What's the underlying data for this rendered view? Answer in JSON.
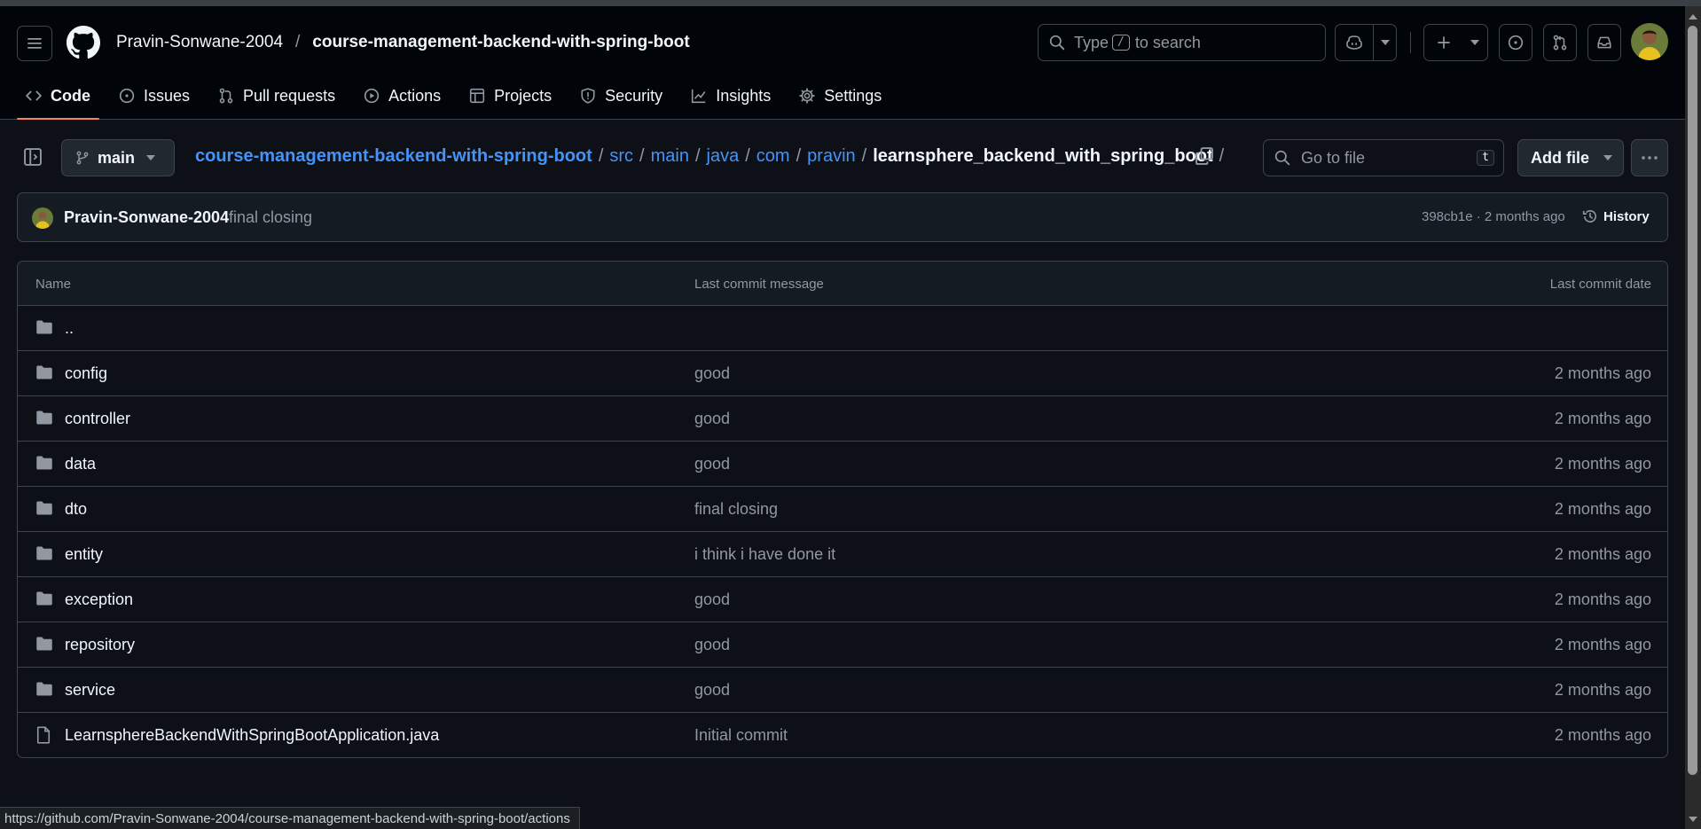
{
  "header": {
    "owner": "Pravin-Sonwane-2004",
    "separator": "/",
    "repo": "course-management-backend-with-spring-boot",
    "search_prefix": "Type",
    "search_key": "/",
    "search_suffix": "to search"
  },
  "tabs": [
    {
      "label": "Code",
      "icon": "code-icon",
      "active": true
    },
    {
      "label": "Issues",
      "icon": "issue-opened-icon"
    },
    {
      "label": "Pull requests",
      "icon": "git-pull-request-icon"
    },
    {
      "label": "Actions",
      "icon": "play-icon"
    },
    {
      "label": "Projects",
      "icon": "table-icon"
    },
    {
      "label": "Security",
      "icon": "shield-icon"
    },
    {
      "label": "Insights",
      "icon": "graph-icon"
    },
    {
      "label": "Settings",
      "icon": "gear-icon"
    }
  ],
  "filenav": {
    "branch": "main",
    "breadcrumb": [
      "course-management-backend-with-spring-boot",
      "src",
      "main",
      "java",
      "com",
      "pravin"
    ],
    "current": "learnsphere_backend_with_spring_boot",
    "trailing_sep": "/",
    "goto_placeholder": "Go to file",
    "goto_key": "t",
    "add_file": "Add file"
  },
  "commit": {
    "author": "Pravin-Sonwane-2004",
    "message": "final closing",
    "meta": "398cb1e · 2 months ago",
    "history": "History"
  },
  "table": {
    "headers": {
      "name": "Name",
      "message": "Last commit message",
      "date": "Last commit date"
    },
    "rows": [
      {
        "name": "..",
        "type": "folder",
        "message": "",
        "date": ""
      },
      {
        "name": "config",
        "type": "folder",
        "message": "good",
        "date": "2 months ago"
      },
      {
        "name": "controller",
        "type": "folder",
        "message": "good",
        "date": "2 months ago"
      },
      {
        "name": "data",
        "type": "folder",
        "message": "good",
        "date": "2 months ago"
      },
      {
        "name": "dto",
        "type": "folder",
        "message": "final closing",
        "date": "2 months ago"
      },
      {
        "name": "entity",
        "type": "folder",
        "message": "i think i have done it",
        "date": "2 months ago"
      },
      {
        "name": "exception",
        "type": "folder",
        "message": "good",
        "date": "2 months ago"
      },
      {
        "name": "repository",
        "type": "folder",
        "message": "good",
        "date": "2 months ago"
      },
      {
        "name": "service",
        "type": "folder",
        "message": "good",
        "date": "2 months ago"
      },
      {
        "name": "LearnsphereBackendWithSpringBootApplication.java",
        "type": "file",
        "message": "Initial commit",
        "date": "2 months ago"
      }
    ]
  },
  "status_url": "https://github.com/Pravin-Sonwane-2004/course-management-backend-with-spring-boot/actions",
  "colors": {
    "accent": "#4493f8",
    "tab_underline": "#f78166",
    "background": "#0d1117",
    "header_bg": "#010409"
  }
}
